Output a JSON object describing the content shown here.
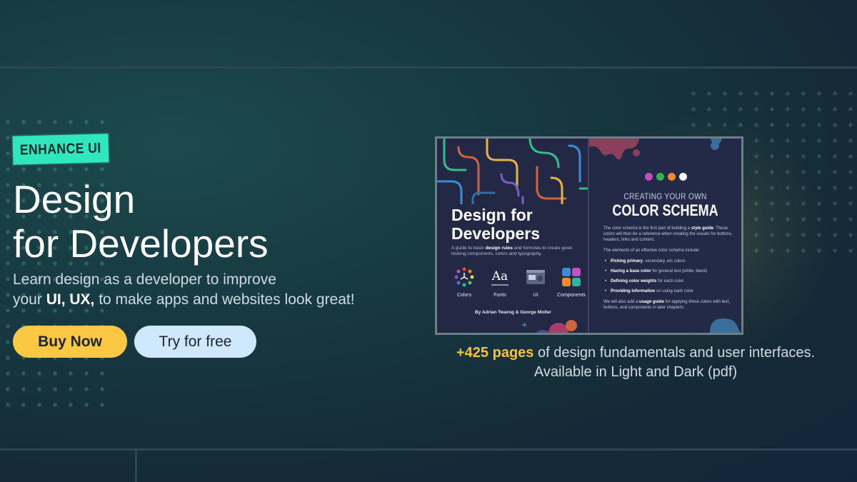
{
  "badge": "ENHANCE UI",
  "title": {
    "line1": "Design",
    "line2": "for Developers"
  },
  "subtitle": {
    "line1": "Learn design as a developer to improve",
    "line2_pre": "your ",
    "line2_bold": "UI, UX,",
    "line2_post": " to make apps and websites look great!"
  },
  "buttons": {
    "buy": "Buy Now",
    "try": "Try for free"
  },
  "book": {
    "cover_title_1": "Design for",
    "cover_title_2": "Developers",
    "cover_desc_pre": "A guide to basic ",
    "cover_desc_bold": "design rules",
    "cover_desc_post": " and formulas to create good looking components, colors and typography.",
    "icons": [
      {
        "label": "Colors",
        "icon": "color-wheel-icon"
      },
      {
        "label": "Fonts",
        "icon": "typography-icon"
      },
      {
        "label": "UI",
        "icon": "ui-window-icon"
      },
      {
        "label": "Components",
        "icon": "puzzle-icon"
      }
    ],
    "font_sample": "Aa",
    "authors": "By Adrian Twarog & George Moller",
    "schema_kicker": "CREATING YOUR OWN",
    "schema_title": "COLOR SCHEMA",
    "schema_p1_pre": "The color schema is the first part of building a ",
    "schema_p1_bold": "style guide",
    "schema_p1_post": ". These colors will then be a reference when creating the visuals for buttons, headers, links and content.",
    "schema_p2": "The elements of an effective color schema include:",
    "schema_list": [
      {
        "bold": "Picking primary",
        "rest": ", secondary, etc colors"
      },
      {
        "bold": "Having a base color",
        "rest": " for general text (white, black)"
      },
      {
        "bold": "Defining color weights",
        "rest": " for each color"
      },
      {
        "bold": "Providing information",
        "rest": " on using each color"
      }
    ],
    "schema_p3_pre": "We will also add a ",
    "schema_p3_bold": "usage guide",
    "schema_p3_post": " for applying these colors with text, buttons, and components in later chapters.",
    "swatch_colors": [
      "#c04fc0",
      "#2fb34a",
      "#f08b2c",
      "#f4f4f4"
    ]
  },
  "caption": {
    "highlight": "+425 pages",
    "line1_rest": " of design fundamentals and user interfaces.",
    "line2": "Available in Light and Dark (pdf)"
  },
  "colors": {
    "accent": "#2fe6bd",
    "buy": "#fcc844",
    "try": "#cfe8fc",
    "highlight": "#f7c23c"
  }
}
